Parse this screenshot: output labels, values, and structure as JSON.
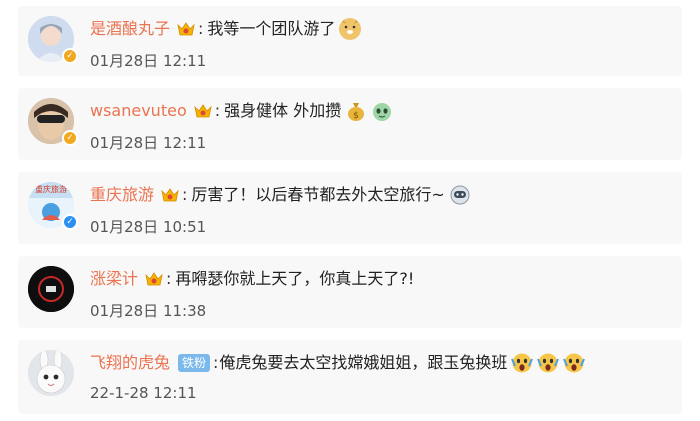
{
  "comments": [
    {
      "username": "是酒酿丸子",
      "text": "我等一个团队游了",
      "time": "01月28日 12:11",
      "verified": "gold",
      "emojis": [
        "doge-emoji"
      ]
    },
    {
      "username": "wsanevuteo",
      "text": "强身健体 外加攒",
      "time": "01月28日 12:11",
      "verified": "gold",
      "emojis": [
        "money-bag-emoji",
        "alien-emoji"
      ]
    },
    {
      "username": "重庆旅游",
      "avatar_text": "重庆旅游",
      "text": "厉害了！以后春节都去外太空旅行~",
      "time": "01月28日 10:51",
      "verified": "blue",
      "emojis": [
        "astronaut-emoji"
      ]
    },
    {
      "username": "涨梁计",
      "text": "再嘚瑟你就上天了，你真上天了?!",
      "time": "01月28日 11:38",
      "verified": "none",
      "emojis": []
    },
    {
      "username": "飞翔的虎兔",
      "fan_badge": "铁粉",
      "text": "俺虎兔要去太空找嫦娥姐姐，跟玉兔换班",
      "time": "22-1-28 12:11",
      "verified": "none",
      "emojis": [
        "scream-emoji",
        "scream-emoji",
        "scream-emoji"
      ]
    }
  ],
  "colors": {
    "username": "#eb7350",
    "card_bg": "#f8f8f8",
    "verified_gold": "#f0a81f",
    "verified_blue": "#2a8ff0",
    "fan_badge": "#7bb8ec"
  }
}
